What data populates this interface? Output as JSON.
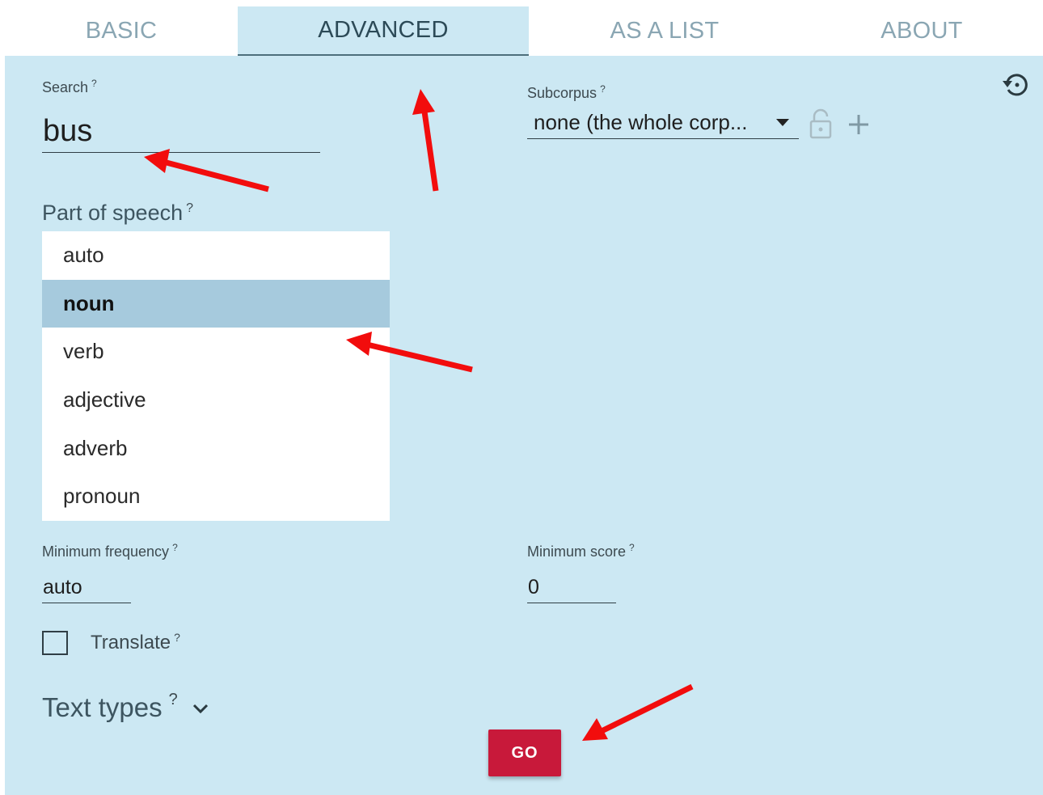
{
  "tabs": [
    {
      "label": "BASIC",
      "active": false
    },
    {
      "label": "ADVANCED",
      "active": true
    },
    {
      "label": "AS A LIST",
      "active": false
    },
    {
      "label": "ABOUT",
      "active": false
    }
  ],
  "search": {
    "label": "Search",
    "help": "?",
    "value": "bus"
  },
  "subcorpus": {
    "label": "Subcorpus",
    "help": "?",
    "value": "none (the whole corp..."
  },
  "pos": {
    "label": "Part of speech",
    "help": "?",
    "options": [
      "auto",
      "noun",
      "verb",
      "adjective",
      "adverb",
      "pronoun"
    ],
    "selected": "noun"
  },
  "min_frequency": {
    "label": "Minimum frequency",
    "help": "?",
    "value": "auto"
  },
  "min_score": {
    "label": "Minimum score",
    "help": "?",
    "value": "0"
  },
  "translate": {
    "label": "Translate",
    "help": "?",
    "checked": false
  },
  "text_types": {
    "label": "Text types",
    "help": "?"
  },
  "go": {
    "label": "GO"
  },
  "icons": {
    "history": "history-icon",
    "lock": "lock-icon",
    "add": "plus-icon",
    "expand": "chevron-down-icon",
    "caret": "caret-down-icon"
  },
  "colors": {
    "panel_bg": "#cce8f3",
    "active_tab_bg": "#cce8f3",
    "selected_option_bg": "#a6cadd",
    "go_button": "#c8193a",
    "annotation_arrow": "#f20d0d"
  }
}
